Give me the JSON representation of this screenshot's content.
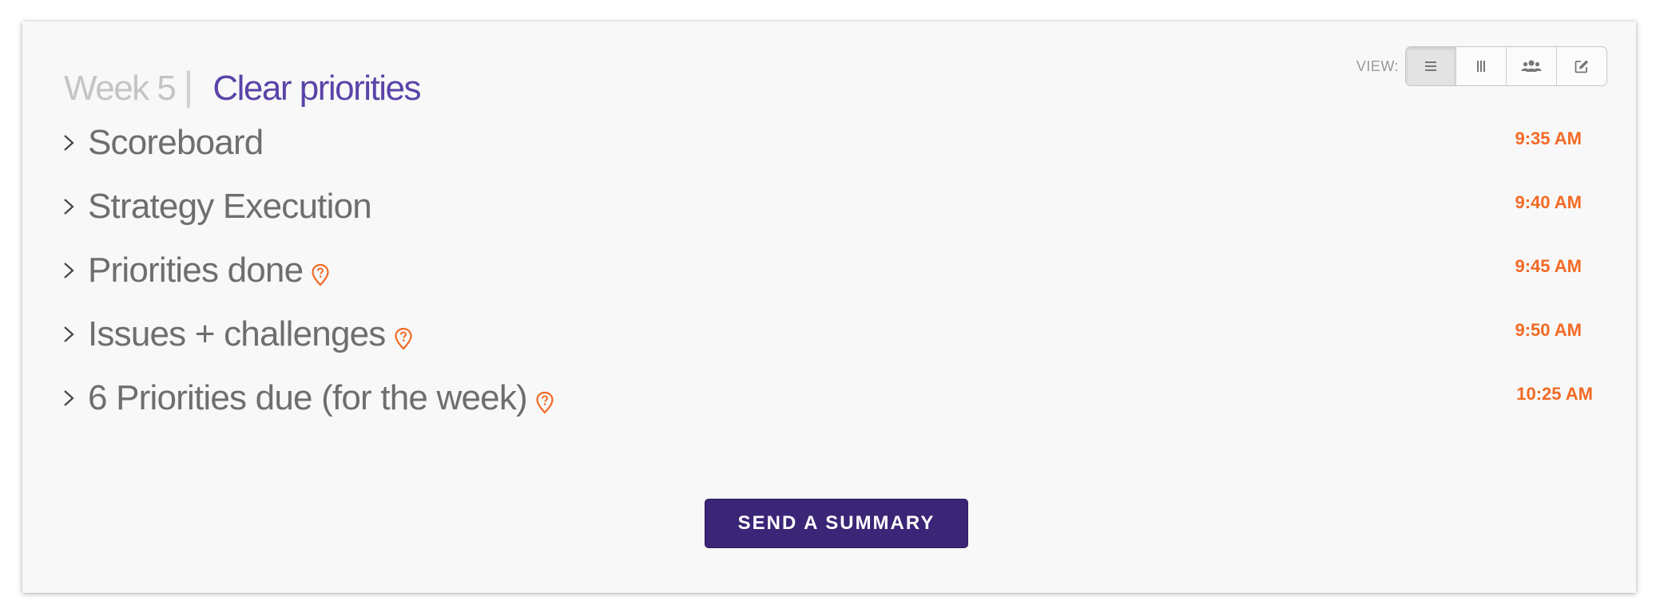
{
  "header": {
    "week_label": "Week 5",
    "separator": "|",
    "title": "Clear priorities"
  },
  "view": {
    "label": "VIEW:",
    "buttons": [
      {
        "icon": "list-icon",
        "active": true
      },
      {
        "icon": "columns-icon",
        "active": false
      },
      {
        "icon": "users-icon",
        "active": false
      },
      {
        "icon": "edit-icon",
        "active": false
      }
    ]
  },
  "agenda": {
    "items": [
      {
        "label": "Scoreboard",
        "time": "9:35 AM",
        "has_help": false
      },
      {
        "label": "Strategy Execution",
        "time": "9:40 AM",
        "has_help": false
      },
      {
        "label": "Priorities done",
        "time": "9:45 AM",
        "has_help": true
      },
      {
        "label": "Issues + challenges",
        "time": "9:50 AM",
        "has_help": true
      },
      {
        "label": "6 Priorities due (for the week)",
        "time": "10:25 AM",
        "has_help": true
      }
    ]
  },
  "actions": {
    "send_summary_label": "SEND A SUMMARY"
  },
  "colors": {
    "accent_purple": "#5a44a8",
    "button_purple": "#3b2576",
    "time_orange": "#f26a25"
  }
}
